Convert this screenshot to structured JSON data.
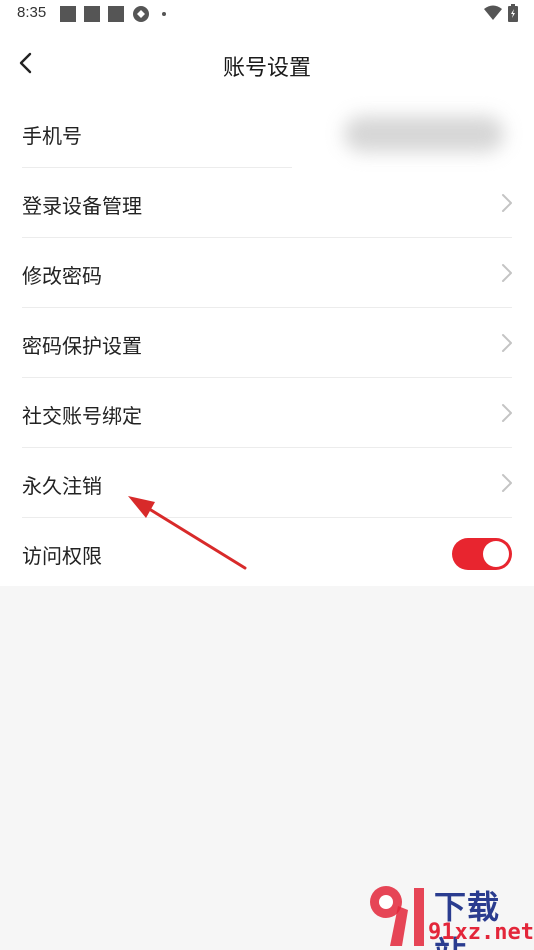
{
  "status_bar": {
    "time": "8:35"
  },
  "header": {
    "title": "账号设置"
  },
  "settings": {
    "phone": {
      "label": "手机号"
    },
    "items": [
      {
        "label": "登录设备管理"
      },
      {
        "label": "修改密码"
      },
      {
        "label": "密码保护设置"
      },
      {
        "label": "社交账号绑定"
      },
      {
        "label": "永久注销"
      }
    ],
    "access": {
      "label": "访问权限",
      "toggle_on": true
    }
  },
  "colors": {
    "accent": "#e8252f",
    "annotation_arrow": "#d82a2a",
    "chevron": "#c4c4c4",
    "background": "#f6f6f6"
  },
  "icons": [
    "back-arrow-icon",
    "chevron-right-icon",
    "wifi-icon",
    "battery-icon"
  ],
  "watermark": {
    "line1": "下载站",
    "line2": "91xz.net"
  }
}
